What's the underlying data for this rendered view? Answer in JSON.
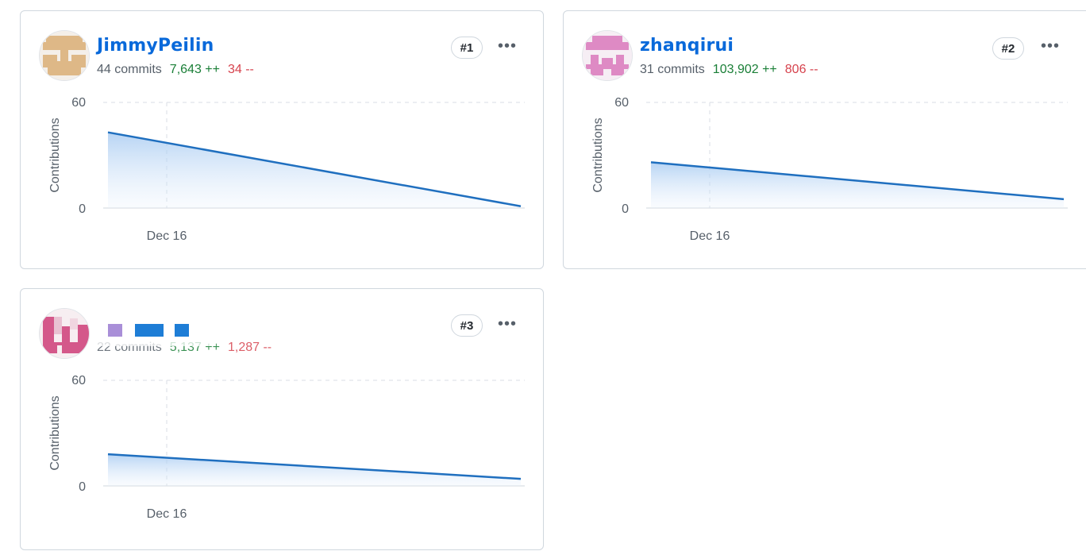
{
  "contributors": [
    {
      "id": "card-1",
      "name": "JimmyPeilin",
      "commits": "44 commits",
      "additions": "7,643 ++",
      "deletions": "34 --",
      "rank": "#1",
      "avatar_color": "#deb887"
    },
    {
      "id": "card-2",
      "name": "zhanqirui",
      "commits": "31 commits",
      "additions": "103,902 ++",
      "deletions": "806 --",
      "rank": "#2",
      "avatar_color": "#de8ac4"
    },
    {
      "id": "card-3",
      "name": "",
      "commits": "22 commits",
      "additions": "5,137 ++",
      "deletions": "1,287 --",
      "rank": "#3",
      "avatar_color": "#d4588a"
    }
  ],
  "menu_icon": "kebab-horizontal-icon",
  "colors": {
    "line": "#1f6fbf",
    "link": "#0969da",
    "add": "#1a7f37",
    "del": "#cf222e"
  },
  "chart_data": [
    {
      "type": "area",
      "ylabel": "Contributions",
      "ylim": [
        0,
        60
      ],
      "y_ticks": [
        "60",
        "0"
      ],
      "x_ticks": [
        "Dec 16"
      ],
      "series": [
        {
          "values": [
            43,
            1
          ]
        }
      ]
    },
    {
      "type": "area",
      "ylabel": "Contributions",
      "ylim": [
        0,
        60
      ],
      "y_ticks": [
        "60",
        "0"
      ],
      "x_ticks": [
        "Dec 16"
      ],
      "series": [
        {
          "values": [
            26,
            5
          ]
        }
      ]
    },
    {
      "type": "area",
      "ylabel": "Contributions",
      "ylim": [
        0,
        60
      ],
      "y_ticks": [
        "60",
        "0"
      ],
      "x_ticks": [
        "Dec 16"
      ],
      "series": [
        {
          "values": [
            18,
            4
          ]
        }
      ]
    }
  ]
}
